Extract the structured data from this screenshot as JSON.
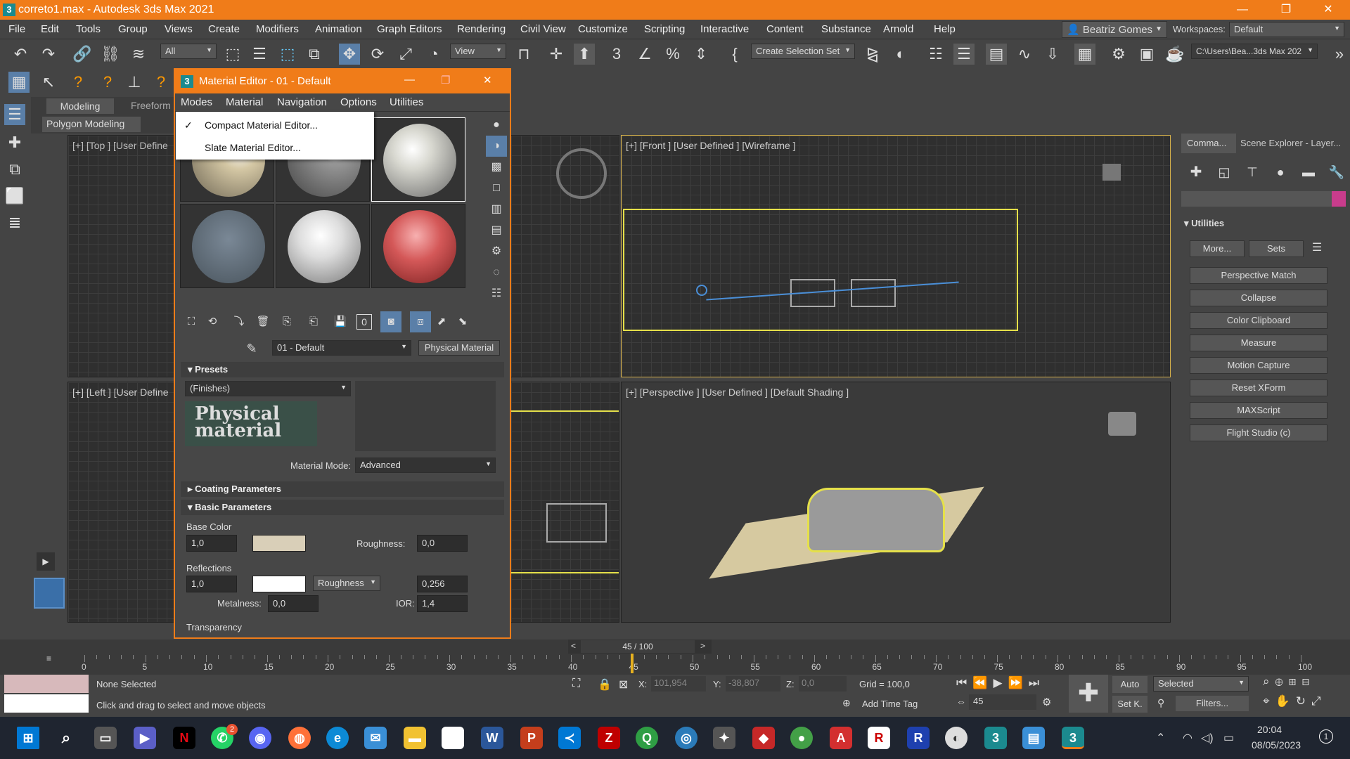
{
  "window": {
    "title": "correto1.max - Autodesk 3ds Max 2021",
    "min": "—",
    "max": "❐",
    "close": "✕"
  },
  "menu": [
    "File",
    "Edit",
    "Tools",
    "Group",
    "Views",
    "Create",
    "Modifiers",
    "Animation",
    "Graph Editors",
    "Rendering",
    "Civil View",
    "Customize",
    "Scripting",
    "Interactive",
    "Content",
    "Substance",
    "Arnold",
    "Help"
  ],
  "user": {
    "name": "Beatriz Gomes",
    "workspaces_label": "Workspaces:",
    "workspace": "Default"
  },
  "toolbar": {
    "filter": "All",
    "refcoord": "View",
    "selection_set": "Create Selection Set",
    "path": "C:\\Users\\Bea...3ds Max 202"
  },
  "ribbon": {
    "tab_modeling": "Modeling",
    "tab_freeform": "Freeform",
    "sub": "Polygon Modeling"
  },
  "viewports": {
    "top": "[+] [Top ] [User Define",
    "front": "[+] [Front ] [User Defined ] [Wireframe ]",
    "left": "[+] [Left ] [User Define",
    "persp": "[+] [Perspective ] [User Defined ] [Default Shading ]"
  },
  "cmdpanel": {
    "tab1": "Comma...",
    "tab2": "Scene Explorer - Layer...",
    "rollout": "Utilities",
    "more": "More...",
    "sets": "Sets",
    "buttons": [
      "Perspective Match",
      "Collapse",
      "Color Clipboard",
      "Measure",
      "Motion Capture",
      "Reset XForm",
      "MAXScript",
      "Flight Studio (c)"
    ]
  },
  "material_editor": {
    "title": "Material Editor - 01 - Default",
    "menu": [
      "Modes",
      "Material",
      "Navigation",
      "Options",
      "Utilities"
    ],
    "dropdown": {
      "item1": "Compact Material Editor...",
      "item2": "Slate Material Editor...",
      "check": "✓"
    },
    "material_name": "01 - Default",
    "material_type": "Physical Material",
    "presets_title": "Presets",
    "presets_value": "(Finishes)",
    "logo_text": "Physical material",
    "mode_label": "Material Mode:",
    "mode_value": "Advanced",
    "coating": "Coating Parameters",
    "basic": "Basic Parameters",
    "base_color_label": "Base Color",
    "base_weight": "1,0",
    "roughness_label": "Roughness:",
    "roughness_value": "0,0",
    "reflections_label": "Reflections",
    "refl_weight": "1,0",
    "refl_mode": "Roughness",
    "refl_rough": "0,256",
    "metalness_label": "Metalness:",
    "metalness_value": "0,0",
    "ior_label": "IOR:",
    "ior_value": "1,4",
    "transparency": "Transparency",
    "zero_btn": "0"
  },
  "timeline": {
    "frame": "45 / 100",
    "ticks": [
      "0",
      "5",
      "10",
      "15",
      "20",
      "25",
      "30",
      "35",
      "40",
      "45",
      "50",
      "55",
      "60",
      "65",
      "70",
      "75",
      "80",
      "85",
      "90",
      "95",
      "100"
    ],
    "current": 45
  },
  "status": {
    "selection": "None Selected",
    "hint": "Click and drag to select and move objects",
    "x_label": "X:",
    "x": "101,954",
    "y_label": "Y:",
    "y": "-38,807",
    "z_label": "Z:",
    "z": "0,0",
    "grid": "Grid = 100,0",
    "add_time_tag": "Add Time Tag",
    "auto": "Auto",
    "setk": "Set K.",
    "selected": "Selected",
    "filters": "Filters...",
    "frame_spinner": "45"
  },
  "taskbar": {
    "time": "20:04",
    "date": "08/05/2023",
    "whatsapp_badge": "2",
    "notif": "1"
  }
}
